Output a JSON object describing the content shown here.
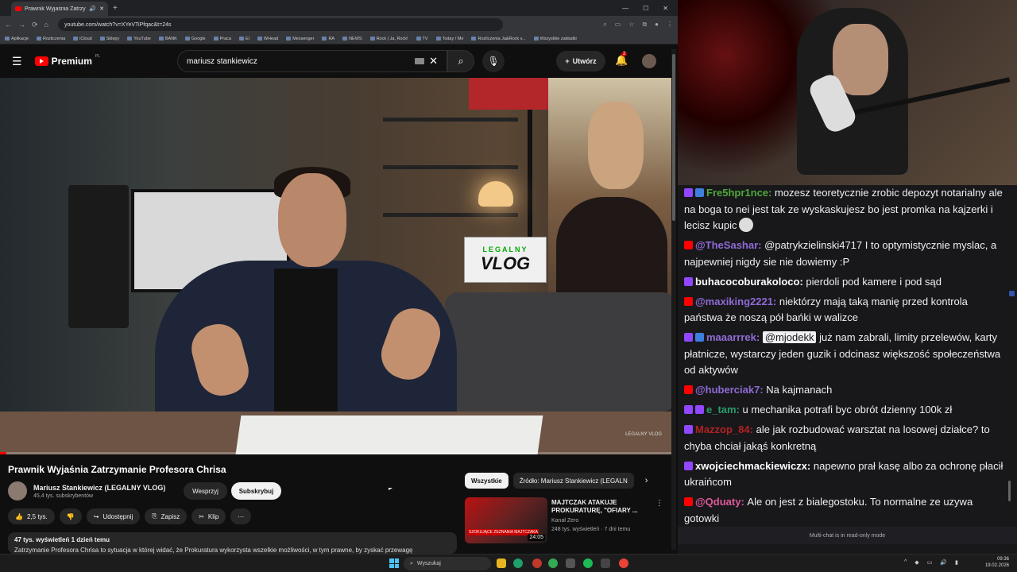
{
  "browser": {
    "tab_title": "Prawnik Wyjaśnia Zatrzymu",
    "url": "youtube.com/watch?v=XYeVTiPfqac&t=24s",
    "bookmarks": [
      "Aplikacje",
      "Rozliczenia",
      "iCloud",
      "Sklepy",
      "YouTube",
      "BANK",
      "Google",
      "Praca",
      "El",
      "WHead",
      "Messenger",
      "RA",
      "NEWS",
      "Rock | Ja, Rock!",
      "TV",
      "Today / Me",
      "Rozliczenia Ja&Rock v...",
      "Wszystkie zakładki"
    ]
  },
  "youtube": {
    "brand": "Premium",
    "region": "PL",
    "search_query": "mariusz stankiewicz",
    "create_label": "Utwórz",
    "notifications_count": "2",
    "video_logo": "LEGALNY VLOG",
    "video_progress": 0.01,
    "video_title": "Prawnik Wyjaśnia Zatrzymanie Profesora Chrisa",
    "channel_name": "Mariusz Stankiewicz (LEGALNY VLOG)",
    "subscribers": "45,4 tys. subskrybentów",
    "support_label": "Wesprzyj",
    "subscribe_label": "Subskrybuj",
    "likes": "2,5 tys.",
    "share_label": "Udostępnij",
    "save_label": "Zapisz",
    "clip_label": "Klip",
    "desc_meta": "47 tys. wyświetleń  1 dzień temu",
    "desc_text": "Zatrzymanie Profesora Chrisa to sytuacja w której widać, że Prokuratura wykorzysta wszelkie możliwości, w tym prawne, by zyskać przewagę",
    "chips": [
      "Wszystkie",
      "Źródło: Mariusz Stankiewicz (LEGALN"
    ],
    "rec": {
      "title": "MAJTCZAK ATAKUJE PROKURATURĘ, \"OFIARY ...",
      "channel": "Kanał Zero",
      "meta": "248 tys. wyświetleń · 7 dni temu",
      "duration": "24:05",
      "thumb_caption": "SZOKUJĄCE ZEZNANIA MAJTCZAKA"
    }
  },
  "chat": {
    "messages": [
      {
        "platform": "tw",
        "user": "Fre5hpr1nce",
        "color": "#4fa83a",
        "text": "mozesz teoretycznie zrobic depozyt notarialny ale na boga to nei jest tak ze wyskaskujesz bo jest promka na kajzerki i lecisz kupic"
      },
      {
        "platform": "yt",
        "user": "@TheSashar",
        "color": "#8f6bd6",
        "text": "@patrykzielinski4717 I to optymistycznie myslac, a najpewniej nigdy sie nie dowiemy :P"
      },
      {
        "platform": "tw",
        "user": "buhacocoburakoloco",
        "color": "#ffffff",
        "text": "pierdoli pod kamere i pod sąd"
      },
      {
        "platform": "yt",
        "user": "@maxiking2221",
        "color": "#8f6bd6",
        "text": "niektórzy mają taką manię przed kontrola państwa że noszą pół bańki w walizce"
      },
      {
        "platform": "tw",
        "user": "maaarrrek",
        "color": "#8f6bd6",
        "mention": "@mjodekk",
        "text": "już nam zabrali, limity przelewów, karty płatnicze, wystarczy jeden guzik i odcinasz większość społeczeństwa od aktywów"
      },
      {
        "platform": "yt",
        "user": "@huberciak7",
        "color": "#8f6bd6",
        "text": "Na kajmanach"
      },
      {
        "platform": "tw",
        "user": "e_tam",
        "color": "#2a9d6a",
        "text": "u mechanika potrafi byc obrót dzienny 100k zł"
      },
      {
        "platform": "tw",
        "user": "Mazzop_84",
        "color": "#b22222",
        "text": "ale jak rozbudować warsztat na losowej działce? to chyba chciał jakąś konkretną"
      },
      {
        "platform": "tw",
        "user": "xwojciechmackiewiczx",
        "color": "#ffffff",
        "text": "napewno prał kasę albo za ochronę płacił ukraińcom"
      },
      {
        "platform": "yt",
        "user": "@Qduaty",
        "color": "#e05a9a",
        "text": "Ale on jest z bialegostoku. To normalne ze uzywa gotowki"
      }
    ],
    "readonly_note": "Multi-chat is in read-only mode"
  },
  "taskbar": {
    "search_placeholder": "Wyszukaj",
    "time": "09:36",
    "date": "19.02.2026"
  }
}
